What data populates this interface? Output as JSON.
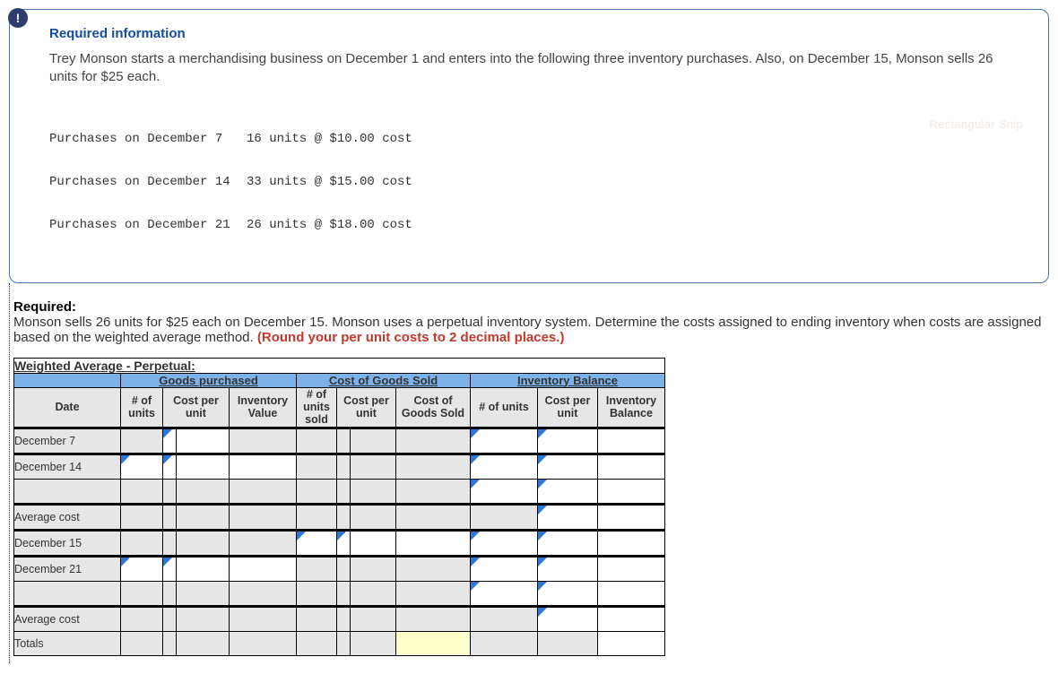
{
  "info": {
    "header": "Required information",
    "paragraph": "Trey Monson starts a merchandising business on December 1 and enters into the following three inventory purchases. Also, on December 15, Monson sells 26 units for $25 each.",
    "watermark": "Rectangular Snip",
    "purchases": [
      {
        "label": "Purchases on December 7",
        "detail": "16 units @ $10.00 cost"
      },
      {
        "label": "Purchases on December 14",
        "detail": "33 units @ $15.00 cost"
      },
      {
        "label": "Purchases on December 21",
        "detail": "26 units @ $18.00 cost"
      }
    ]
  },
  "required": {
    "label": "Required:",
    "text": "Monson sells 26 units for $25 each on December 15. Monson uses a perpetual inventory system. Determine the costs assigned to ending inventory when costs are assigned based on the weighted average method.",
    "note": "(Round your per unit costs to 2 decimal places.)"
  },
  "table": {
    "title": "Weighted Average - Perpetual:",
    "group_headers": [
      "Goods purchased",
      "Cost of Goods Sold",
      "Inventory Balance"
    ],
    "col_headers": {
      "date": "Date",
      "g_units": "# of units",
      "g_cpu": "Cost per unit",
      "g_inv": "Inventory Value",
      "s_units": "# of units sold",
      "s_cpu": "Cost per unit",
      "s_cogs": "Cost of Goods Sold",
      "b_units": "# of units",
      "b_cpu": "Cost per unit",
      "b_bal": "Inventory Balance"
    },
    "rows": [
      {
        "date": "December 7"
      },
      {
        "date": "December 14"
      },
      {
        "date": ""
      },
      {
        "date": "Average cost"
      },
      {
        "date": "December 15"
      },
      {
        "date": "December 21"
      },
      {
        "date": ""
      },
      {
        "date": "Average cost"
      },
      {
        "date": "Totals"
      }
    ]
  }
}
